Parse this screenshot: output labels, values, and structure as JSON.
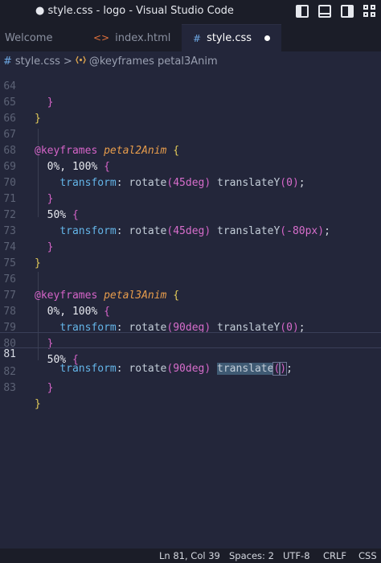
{
  "window": {
    "title": "● style.css - logo - Visual Studio Code"
  },
  "title_icons": [
    "toggle-primary-sidebar-icon",
    "toggle-panel-icon",
    "toggle-secondary-sidebar-icon",
    "customize-layout-icon"
  ],
  "tabs": [
    {
      "label": "Welcome",
      "icon": ""
    },
    {
      "label": "index.html",
      "icon": "<>"
    },
    {
      "label": "style.css",
      "icon": "#",
      "modified": true
    }
  ],
  "breadcrumb": {
    "file": "style.css",
    "file_icon": "#",
    "separator": ">",
    "symbol": "@keyframes petal3Anim"
  },
  "editor": {
    "current_line": 81,
    "lines": [
      {
        "n": "64",
        "text": "  }"
      },
      {
        "n": "65",
        "text": "}"
      },
      {
        "n": "66",
        "text": ""
      },
      {
        "n": "67",
        "text": "@keyframes petal2Anim {"
      },
      {
        "n": "68",
        "text": "  0%, 100% {"
      },
      {
        "n": "69",
        "text": "    transform: rotate(45deg) translateY(0);"
      },
      {
        "n": "70",
        "text": "  }"
      },
      {
        "n": "71",
        "text": "  50% {"
      },
      {
        "n": "72",
        "text": "    transform: rotate(45deg) translateY(-80px);"
      },
      {
        "n": "73",
        "text": "  }"
      },
      {
        "n": "74",
        "text": "}"
      },
      {
        "n": "75",
        "text": ""
      },
      {
        "n": "76",
        "text": "@keyframes petal3Anim {"
      },
      {
        "n": "77",
        "text": "  0%, 100% {"
      },
      {
        "n": "78",
        "text": "    transform: rotate(90deg) translateY(0);"
      },
      {
        "n": "79",
        "text": "  }"
      },
      {
        "n": "80",
        "text": "  50% {"
      },
      {
        "n": "81",
        "text": "    transform: rotate(90deg) translate();"
      },
      {
        "n": "82",
        "text": "  }"
      },
      {
        "n": "83",
        "text": "}"
      }
    ]
  },
  "statusbar": {
    "position": "Ln 81, Col 39",
    "spaces": "Spaces: 2",
    "encoding": "UTF-8",
    "eol": "CRLF",
    "language": "CSS"
  }
}
